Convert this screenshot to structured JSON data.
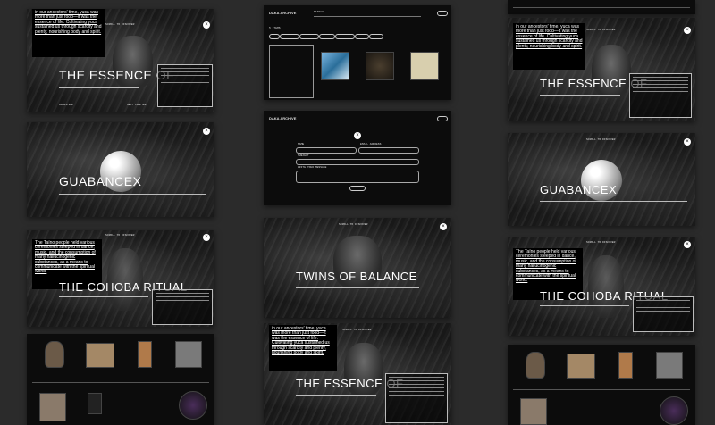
{
  "essence_title": "THE ESSENCE OF",
  "guabancex_title": "GUABANCEX",
  "cohoba_title": "THE COHOBA RITUAL",
  "twins_title": "TWINS OF BALANCE",
  "scroll_label": "SCROLL TO DISCOVER",
  "archive_title": "DAKA ARCHIVE",
  "archive_search_label": "SEARCH",
  "archive_menu_button": "MENU",
  "archive_count": "5 ITEMS",
  "close_symbol": "×",
  "quote_essence": "in our ancestors' time, yuca was more than just food—it was the essence of life. Cultivating yuca sustained us through scarcity and plenty, nourishing body and spirit.",
  "quote_taino": "The Taíno people held various ceremonies steeped in dance, music, and the consumption of many hallucinogenic substances, as a means to communicate with the spiritual world.",
  "archive_filters": [
    "ALL",
    "MYTHS & LEGENDS",
    "CEREMONIES",
    "SYMBOLS",
    "DAILY LIFE",
    "SPIRITS",
    "FIGURES"
  ],
  "form_labels": {
    "name": "NAME",
    "email": "EMAIL ADDRESS",
    "subject": "SUBJECT",
    "message": "WRITE YOUR MESSAGE",
    "submit": "SUBMIT"
  },
  "footer_left": "ANCESTRAL",
  "footer_right": "NEXT CHAPTER"
}
